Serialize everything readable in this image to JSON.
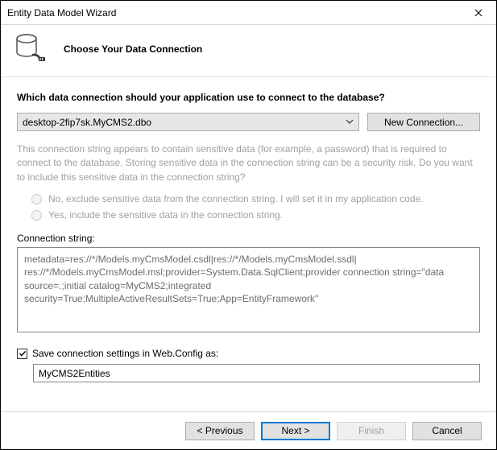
{
  "window": {
    "title": "Entity Data Model Wizard"
  },
  "header": {
    "title": "Choose Your Data Connection"
  },
  "question": "Which data connection should your application use to connect to the database?",
  "combo": {
    "selected": "desktop-2fip7sk.MyCMS2.dbo"
  },
  "buttons": {
    "newConnection": "New Connection...",
    "previous": "< Previous",
    "next": "Next >",
    "finish": "Finish",
    "cancel": "Cancel"
  },
  "warning": "This connection string appears to contain sensitive data (for example, a password) that is required to connect to the database. Storing sensitive data in the connection string can be a security risk. Do you want to include this sensitive data in the connection string?",
  "radio": {
    "exclude": "No, exclude sensitive data from the connection string. I will set it in my application code.",
    "include": "Yes, include the sensitive data in the connection string."
  },
  "labels": {
    "connString": "Connection string:",
    "saveCheck": "Save connection settings in Web.Config as:"
  },
  "connString": "metadata=res://*/Models.myCmsModel.csdl|res://*/Models.myCmsModel.ssdl|\nres://*/Models.myCmsModel.msl;provider=System.Data.SqlClient;provider connection string=\"data source=.;initial catalog=MyCMS2;integrated security=True;MultipleActiveResultSets=True;App=EntityFramework\"",
  "settingsName": "MyCMS2Entities",
  "saveChecked": true
}
